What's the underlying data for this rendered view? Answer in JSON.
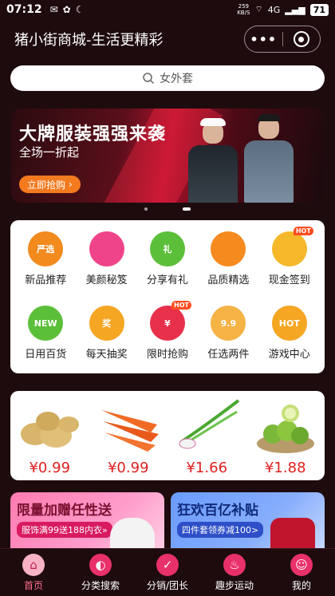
{
  "status_bar": {
    "time": "07:12",
    "speed": "259",
    "speed_unit": "KB/S",
    "network": "4G",
    "battery": "71"
  },
  "navbar": {
    "title": "猪小街商城-生活更精彩"
  },
  "search": {
    "placeholder": "女外套"
  },
  "banner": {
    "headline": "大牌服装强强来袭",
    "subline": "全场一折起",
    "cta": "立即抢购"
  },
  "categories": [
    {
      "label": "新品推荐",
      "icon": "new-arrival-icon",
      "badge": "严选",
      "color": "#f28a1e"
    },
    {
      "label": "美颜秘笈",
      "icon": "beauty-icon",
      "badge": "",
      "color": "#f0448a"
    },
    {
      "label": "分享有礼",
      "icon": "gift-icon",
      "badge": "礼",
      "color": "#5cbf3a"
    },
    {
      "label": "品质精选",
      "icon": "shopping-bag-icon",
      "badge": "",
      "color": "#f58a1f"
    },
    {
      "label": "现金签到",
      "icon": "crown-icon",
      "badge": "",
      "color": "#f5b82a",
      "hot": "HOT"
    },
    {
      "label": "日用百货",
      "icon": "new-badge-icon",
      "badge": "NEW",
      "color": "#5cbf3a"
    },
    {
      "label": "每天抽奖",
      "icon": "lottery-icon",
      "badge": "奖",
      "color": "#f5a623"
    },
    {
      "label": "限时抢购",
      "icon": "flash-sale-icon",
      "badge": "¥",
      "color": "#e8304a",
      "hot": "HOT"
    },
    {
      "label": "任选两件",
      "icon": "box-icon",
      "badge": "9.9",
      "color": "#f5b346"
    },
    {
      "label": "游戏中心",
      "icon": "game-icon",
      "badge": "HOT",
      "color": "#f5a623"
    }
  ],
  "products": [
    {
      "name": "potato",
      "price": "¥0.99"
    },
    {
      "name": "carrot",
      "price": "¥0.99"
    },
    {
      "name": "green-onion",
      "price": "¥1.66"
    },
    {
      "name": "lime",
      "price": "¥1.88"
    }
  ],
  "promos": [
    {
      "title": "限量加赠任性送",
      "tag": "服饰满99送188内衣»"
    },
    {
      "title": "狂欢百亿补贴",
      "tag": "四件套领券减100>"
    }
  ],
  "tabbar": [
    {
      "label": "首页",
      "icon": "home-icon",
      "active": true
    },
    {
      "label": "分类搜索",
      "icon": "compass-icon",
      "active": false
    },
    {
      "label": "分销/团长",
      "icon": "calendar-check-icon",
      "active": false
    },
    {
      "label": "趣步运动",
      "icon": "flame-icon",
      "active": false
    },
    {
      "label": "我的",
      "icon": "user-icon",
      "active": false
    }
  ],
  "colors": {
    "background": "#1e0b0e",
    "accent": "#e8306a",
    "price": "#e02020",
    "cta": "#f47a1f"
  }
}
